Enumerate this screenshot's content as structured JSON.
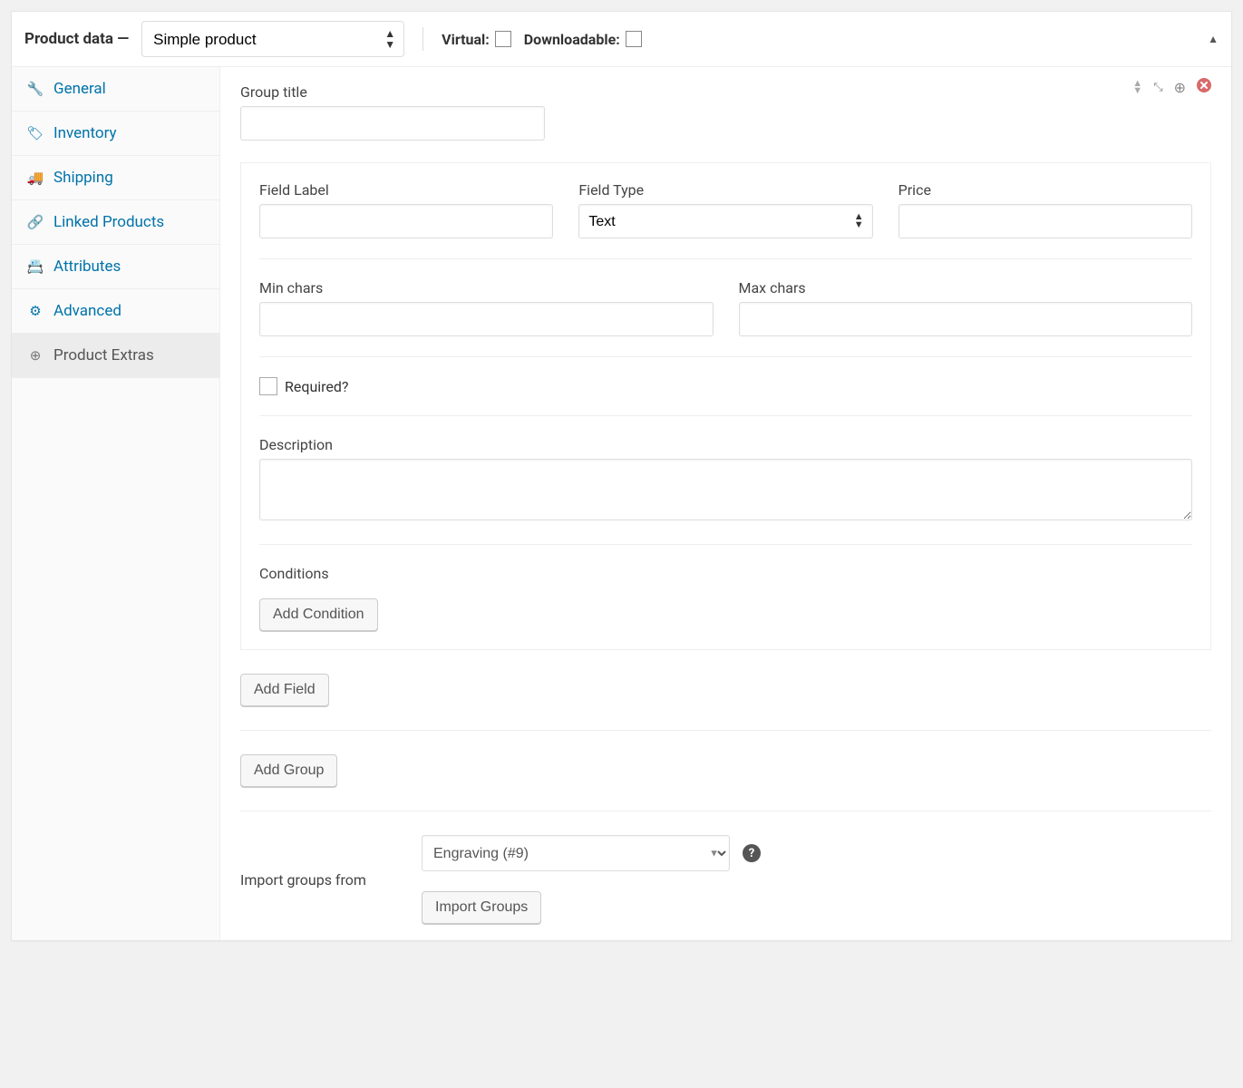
{
  "header": {
    "title": "Product data —",
    "product_type": "Simple product",
    "virtual_label": "Virtual:",
    "downloadable_label": "Downloadable:"
  },
  "tabs": [
    {
      "id": "general",
      "label": "General",
      "icon": "🔧"
    },
    {
      "id": "inventory",
      "label": "Inventory",
      "icon": "🏷"
    },
    {
      "id": "shipping",
      "label": "Shipping",
      "icon": "🚚"
    },
    {
      "id": "linked",
      "label": "Linked Products",
      "icon": "🔗"
    },
    {
      "id": "attributes",
      "label": "Attributes",
      "icon": "📇"
    },
    {
      "id": "advanced",
      "label": "Advanced",
      "icon": "⚙"
    },
    {
      "id": "extras",
      "label": "Product Extras",
      "icon": "⊕"
    }
  ],
  "group": {
    "title_label": "Group title",
    "title_value": ""
  },
  "field": {
    "label_label": "Field Label",
    "label_value": "",
    "type_label": "Field Type",
    "type_value": "Text",
    "price_label": "Price",
    "price_value": "",
    "min_label": "Min chars",
    "min_value": "",
    "max_label": "Max chars",
    "max_value": "",
    "required_label": "Required?",
    "description_label": "Description",
    "description_value": "",
    "conditions_label": "Conditions",
    "add_condition_label": "Add Condition"
  },
  "buttons": {
    "add_field": "Add Field",
    "add_group": "Add Group",
    "import_groups": "Import Groups"
  },
  "import": {
    "label": "Import groups from",
    "selected": "Engraving (#9)"
  }
}
